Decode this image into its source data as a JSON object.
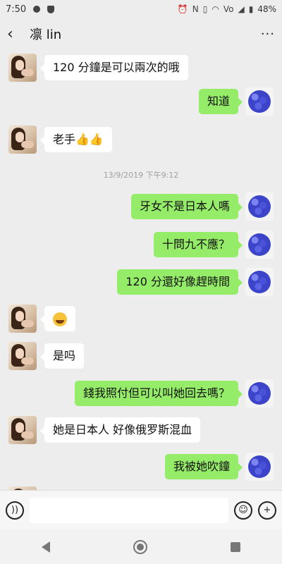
{
  "status_bar": {
    "time": "7:50",
    "battery": "48%",
    "network": "Vo"
  },
  "header": {
    "back_icon": "‹",
    "title": "凛 lin",
    "more_icon": "···"
  },
  "messages": [
    {
      "side": "left",
      "text": "120 分鐘是可以兩次的哦"
    },
    {
      "side": "right",
      "text": "知道"
    },
    {
      "side": "left",
      "text": "老手👍👍"
    },
    {
      "type": "timestamp",
      "text": "13/9/2019 下午9:12"
    },
    {
      "side": "right",
      "text": "牙女不是日本人嗎"
    },
    {
      "side": "right",
      "text": "十問九不應？"
    },
    {
      "side": "right",
      "text": "120 分還好像趕時間"
    },
    {
      "side": "left",
      "emoji": "laughing-crying-emoji"
    },
    {
      "side": "left",
      "text": "是吗"
    },
    {
      "side": "right",
      "text": "錢我照付但可以叫她回去嗎？"
    },
    {
      "side": "left",
      "text": "她是日本人 好像俄罗斯混血"
    },
    {
      "side": "right",
      "text": "我被她吹鐘"
    }
  ],
  "input_bar": {
    "voice_icon": "voice-icon",
    "emoji_icon": "emoji-icon",
    "plus_icon": "plus-icon",
    "value": ""
  },
  "colors": {
    "background": "#ededed",
    "bubble_right": "#95ec69",
    "bubble_left": "#ffffff",
    "timestamp": "#a0a0a0"
  }
}
